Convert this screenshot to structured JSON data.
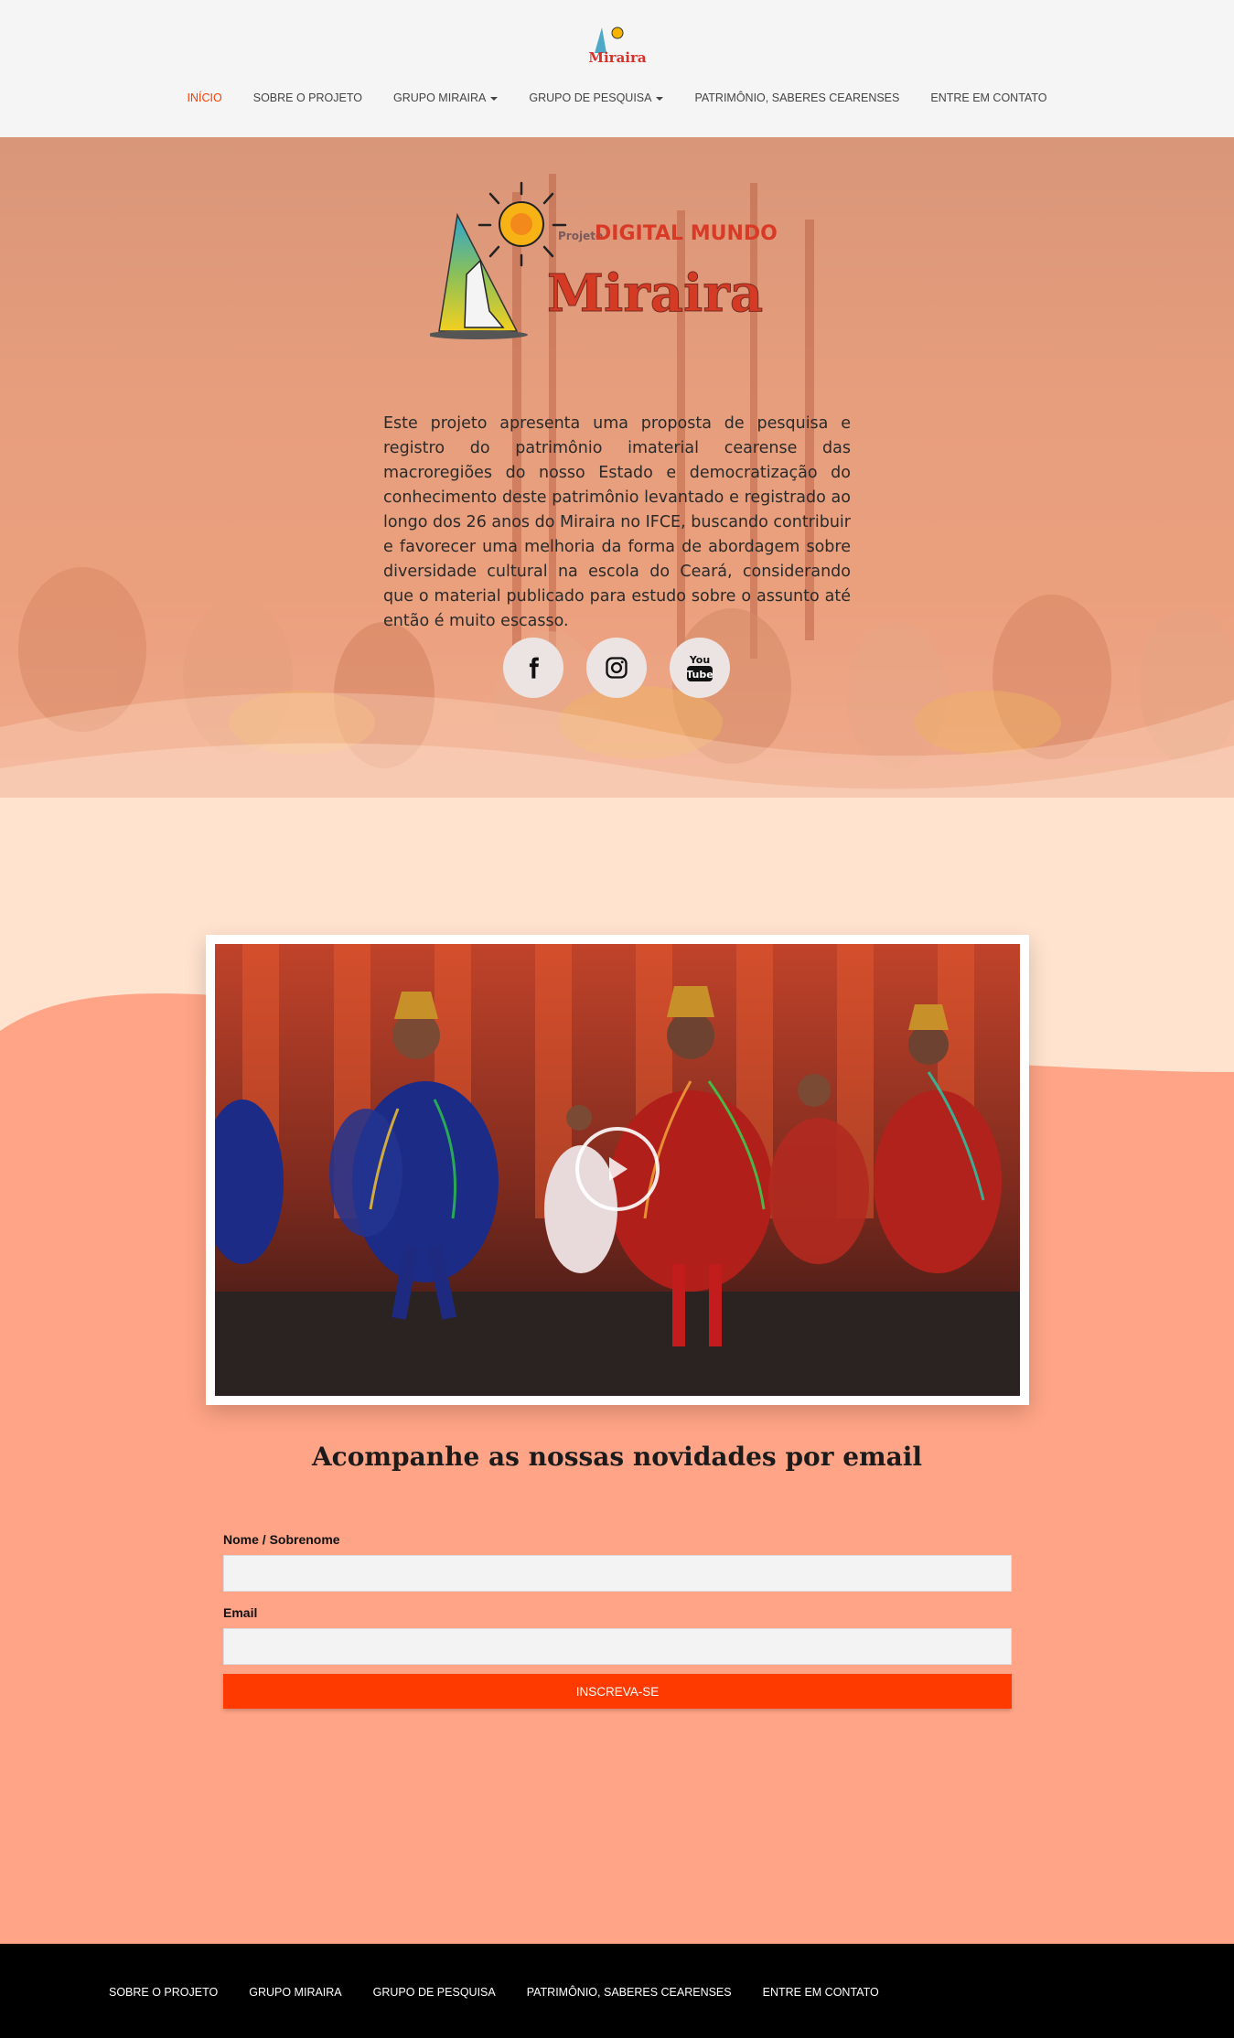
{
  "header": {
    "logo_text": "Miraira",
    "nav": [
      {
        "label": "INÍCIO",
        "active": true
      },
      {
        "label": "SOBRE O PROJETO"
      },
      {
        "label": "GRUPO MIRAIRA",
        "dropdown": true
      },
      {
        "label": "GRUPO DE PESQUISA",
        "dropdown": true
      },
      {
        "label": "PATRIMÔNIO, SABERES CEARENSES"
      },
      {
        "label": "ENTRE EM CONTATO"
      }
    ]
  },
  "hero": {
    "logo": {
      "small": "Projeto",
      "line1": "DIGITAL MUNDO",
      "line2": "Miraira"
    },
    "text": "Este projeto apresenta uma proposta de pesquisa e registro do patrimônio imaterial cearense das macroregiões do nosso Estado e democratização do conhecimento deste patrimônio levantado e registrado ao longo dos 26 anos do Miraira no IFCE, buscando contribuir e favorecer uma melhoria da forma de abordagem sobre diversidade cultural na escola do Ceará, considerando que o material publicado para estudo sobre o assunto até então é muito escasso.",
    "socials": [
      {
        "icon": "facebook-icon"
      },
      {
        "icon": "instagram-icon"
      },
      {
        "icon": "youtube-icon",
        "text_top": "You",
        "text_bottom": "Tube"
      }
    ]
  },
  "newsletter": {
    "title": "Acompanhe as nossas novidades por email",
    "name_label": "Nome / Sobrenome",
    "email_label": "Email",
    "submit": "INSCREVA-SE"
  },
  "footer": {
    "nav": [
      "SOBRE O PROJETO",
      "GRUPO MIRAIRA",
      "GRUPO DE PESQUISA",
      "PATRIMÔNIO, SABERES CEARENSES",
      "ENTRE EM CONTATO"
    ]
  },
  "colors": {
    "accent": "#ff3a00",
    "page_bg": "#ffa486",
    "light_band": "#ffe3cf",
    "footer": "#000000"
  }
}
